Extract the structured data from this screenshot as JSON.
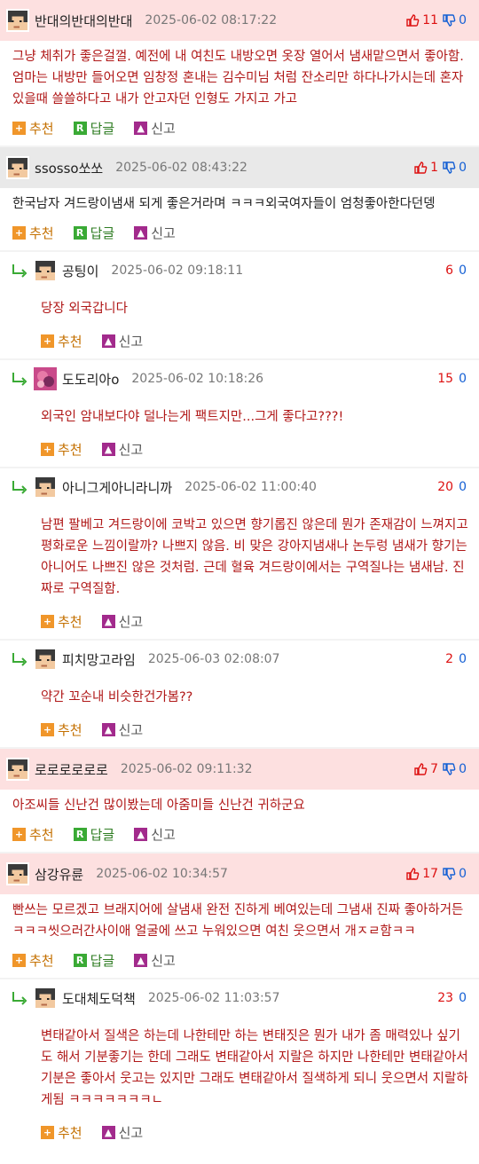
{
  "labels": {
    "recommend": "추천",
    "reply": "답글",
    "report": "신고"
  },
  "colors": {
    "pink_header": "#fde0e0",
    "gray_header": "#e9e9e9",
    "red_text": "#b01818",
    "up": "#d11111",
    "down": "#1560d4"
  },
  "comments": [
    {
      "kind": "top",
      "bg": "pink",
      "nick": "반대의반대의반대",
      "date": "2025-06-02 08:17:22",
      "up": "11",
      "down": "0",
      "text": "그냥 체취가 좋은걸껄. 예전에 내 여친도 내방오면 옷장 열어서 냄새맡으면서 좋아함. 엄마는 내방만 들어오면 임창정 혼내는 김수미님 처럼 잔소리만 하다나가시는데 혼자있을때 쓸쓸하다고 내가 안고자던 인형도 가지고 가고"
    },
    {
      "kind": "top",
      "bg": "gray",
      "nick": "ssosso쏘쏘",
      "date": "2025-06-02 08:43:22",
      "up": "1",
      "down": "0",
      "text": "한국남자 겨드랑이냄새 되게 좋은거라며 ㅋㅋㅋ외국여자들이 엄청좋아한다던뎅"
    },
    {
      "kind": "reply",
      "nick": "공팅이",
      "date": "2025-06-02 09:18:11",
      "up": "6",
      "down": "0",
      "avatar": "pixel",
      "text": "당장 외국갑니다"
    },
    {
      "kind": "reply",
      "nick": "도도리아o",
      "date": "2025-06-02 10:18:26",
      "up": "15",
      "down": "0",
      "avatar": "photo",
      "text": "외국인 암내보다야 덜나는게 팩트지만...그게 좋다고???!"
    },
    {
      "kind": "reply",
      "nick": "아니그게아니라니까",
      "date": "2025-06-02 11:00:40",
      "up": "20",
      "down": "0",
      "avatar": "pixel",
      "text": "남편 팔베고 겨드랑이에 코박고 있으면 향기롭진 않은데 뭔가 존재감이 느껴지고 평화로운 느낌이랄까? 나쁘지 않음. 비 맞은 강아지냄새나 논두렁 냄새가 향기는 아니어도 나쁘진 않은 것처럼. 근데 혈육 겨드랑이에서는 구역질나는 냄새남. 진짜로 구역질함."
    },
    {
      "kind": "reply",
      "nick": "피치망고라임",
      "date": "2025-06-03 02:08:07",
      "up": "2",
      "down": "0",
      "avatar": "pixel",
      "text": "약간 꼬순내 비슷한건가봄??"
    },
    {
      "kind": "top",
      "bg": "pink",
      "nick": "로로로로로로",
      "date": "2025-06-02 09:11:32",
      "up": "7",
      "down": "0",
      "text": "아조씨들 신난건 많이봤는데 아줌미들 신난건 귀하군요"
    },
    {
      "kind": "top",
      "bg": "pink",
      "nick": "삼강유륜",
      "date": "2025-06-02 10:34:57",
      "up": "17",
      "down": "0",
      "text": "빤쓰는 모르겠고 브래지어에 살냄새 완전 진하게 베여있는데 그냄새 진짜 좋아하거든 ㅋㅋㅋ씻으러간사이애 얼굴에 쓰고 누워있으면 여친 웃으면서 개ㅈㄹ함ㅋㅋ"
    },
    {
      "kind": "reply",
      "nick": "도대체도덕책",
      "date": "2025-06-02 11:03:57",
      "up": "23",
      "down": "0",
      "avatar": "pixel",
      "text": "변태같아서 질색은 하는데 나한테만 하는 변태짓은 뭔가 내가 좀 매력있나 싶기도 해서 기분좋기는 한데 그래도 변태같아서 지랄은 하지만 나한테만 변태같아서 기분은 좋아서 웃고는 있지만 그래도 변태같아서 질색하게 되니 웃으면서 지랄하게됨 ㅋㅋㅋㅋㅋㅋㅋㄴ"
    }
  ]
}
